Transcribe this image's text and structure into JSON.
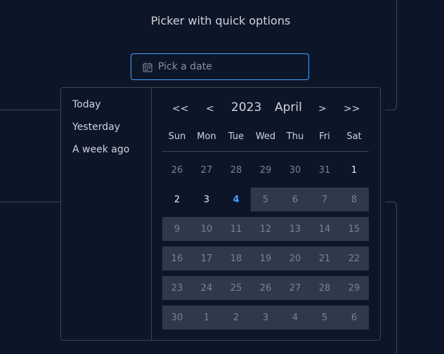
{
  "title": "Picker with quick options",
  "input": {
    "placeholder": "Pick a date",
    "icon": "calendar-icon"
  },
  "colors": {
    "accent": "#409eff",
    "disabled_bg": "#2e3a4a",
    "background": "#0d1628"
  },
  "shortcuts": [
    "Today",
    "Yesterday",
    "A week ago"
  ],
  "header": {
    "prev_year": "<<",
    "prev_month": "<",
    "year": "2023",
    "month": "April",
    "next_month": ">",
    "next_year": ">>"
  },
  "weekdays": [
    "Sun",
    "Mon",
    "Tue",
    "Wed",
    "Thu",
    "Fri",
    "Sat"
  ],
  "weeks": [
    [
      {
        "d": "26",
        "t": "prev"
      },
      {
        "d": "27",
        "t": "prev"
      },
      {
        "d": "28",
        "t": "prev"
      },
      {
        "d": "29",
        "t": "prev"
      },
      {
        "d": "30",
        "t": "prev"
      },
      {
        "d": "31",
        "t": "prev"
      },
      {
        "d": "1",
        "t": "cur"
      }
    ],
    [
      {
        "d": "2",
        "t": "cur"
      },
      {
        "d": "3",
        "t": "cur"
      },
      {
        "d": "4",
        "t": "today"
      },
      {
        "d": "5",
        "t": "disabled"
      },
      {
        "d": "6",
        "t": "disabled"
      },
      {
        "d": "7",
        "t": "disabled"
      },
      {
        "d": "8",
        "t": "disabled"
      }
    ],
    [
      {
        "d": "9",
        "t": "disabled"
      },
      {
        "d": "10",
        "t": "disabled"
      },
      {
        "d": "11",
        "t": "disabled"
      },
      {
        "d": "12",
        "t": "disabled"
      },
      {
        "d": "13",
        "t": "disabled"
      },
      {
        "d": "14",
        "t": "disabled"
      },
      {
        "d": "15",
        "t": "disabled"
      }
    ],
    [
      {
        "d": "16",
        "t": "disabled"
      },
      {
        "d": "17",
        "t": "disabled"
      },
      {
        "d": "18",
        "t": "disabled"
      },
      {
        "d": "19",
        "t": "disabled"
      },
      {
        "d": "20",
        "t": "disabled"
      },
      {
        "d": "21",
        "t": "disabled"
      },
      {
        "d": "22",
        "t": "disabled"
      }
    ],
    [
      {
        "d": "23",
        "t": "disabled"
      },
      {
        "d": "24",
        "t": "disabled"
      },
      {
        "d": "25",
        "t": "disabled"
      },
      {
        "d": "26",
        "t": "disabled"
      },
      {
        "d": "27",
        "t": "disabled"
      },
      {
        "d": "28",
        "t": "disabled"
      },
      {
        "d": "29",
        "t": "disabled"
      }
    ],
    [
      {
        "d": "30",
        "t": "disabled"
      },
      {
        "d": "1",
        "t": "disabled"
      },
      {
        "d": "2",
        "t": "disabled"
      },
      {
        "d": "3",
        "t": "disabled"
      },
      {
        "d": "4",
        "t": "disabled"
      },
      {
        "d": "5",
        "t": "disabled"
      },
      {
        "d": "6",
        "t": "disabled"
      }
    ]
  ]
}
